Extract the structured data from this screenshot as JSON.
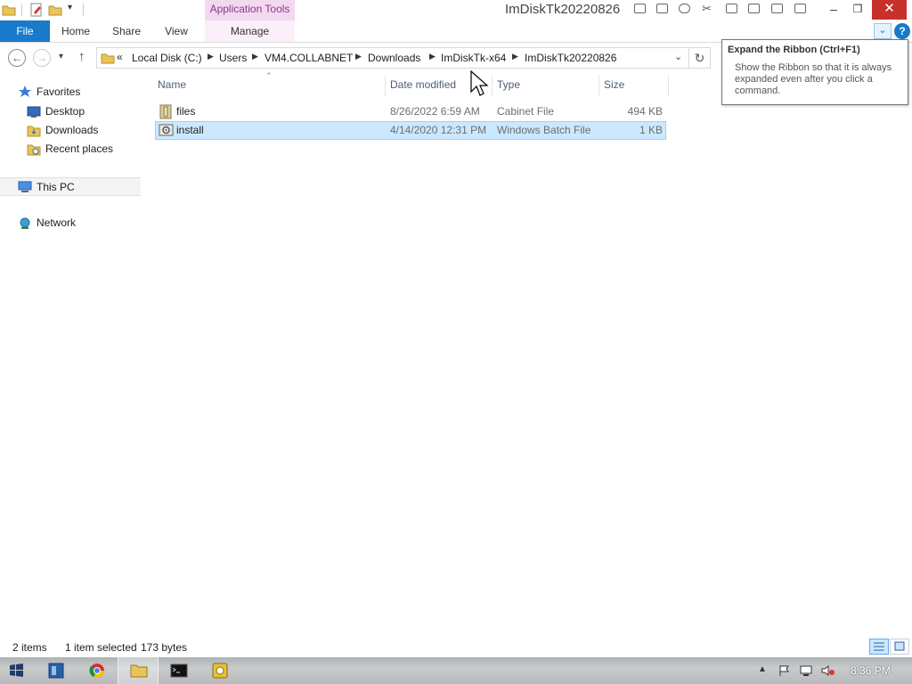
{
  "window": {
    "title": "ImDiskTk20220826",
    "context_tab_group": "Application Tools"
  },
  "ribbon": {
    "tabs": [
      "File",
      "Home",
      "Share",
      "View",
      "Manage"
    ]
  },
  "address": {
    "overflow": "«",
    "crumbs": [
      "Local Disk (C:)",
      "Users",
      "VM4.COLLABNET",
      "Downloads",
      "ImDiskTk-x64",
      "ImDiskTk20220826"
    ]
  },
  "tooltip": {
    "title": "Expand the Ribbon (Ctrl+F1)",
    "body": "Show the Ribbon so that it is always expanded even after you click a command."
  },
  "nav": {
    "favorites": "Favorites",
    "desktop": "Desktop",
    "downloads": "Downloads",
    "recent": "Recent places",
    "thispc": "This PC",
    "network": "Network"
  },
  "columns": {
    "name": "Name",
    "date": "Date modified",
    "type": "Type",
    "size": "Size"
  },
  "files": [
    {
      "name": "files",
      "date": "8/26/2022 6:59 AM",
      "type": "Cabinet File",
      "size": "494 KB",
      "selected": false
    },
    {
      "name": "install",
      "date": "4/14/2020 12:31 PM",
      "type": "Windows Batch File",
      "size": "1 KB",
      "selected": true
    }
  ],
  "status": {
    "count": "2 items",
    "selection": "1 item selected",
    "bytes": "173 bytes"
  },
  "taskbar": {
    "clock": "8:36 PM"
  },
  "colors": {
    "accent": "#1979ca",
    "selection": "#cce8ff",
    "context_tab": "#f3d9f0",
    "close": "#c7312b"
  }
}
